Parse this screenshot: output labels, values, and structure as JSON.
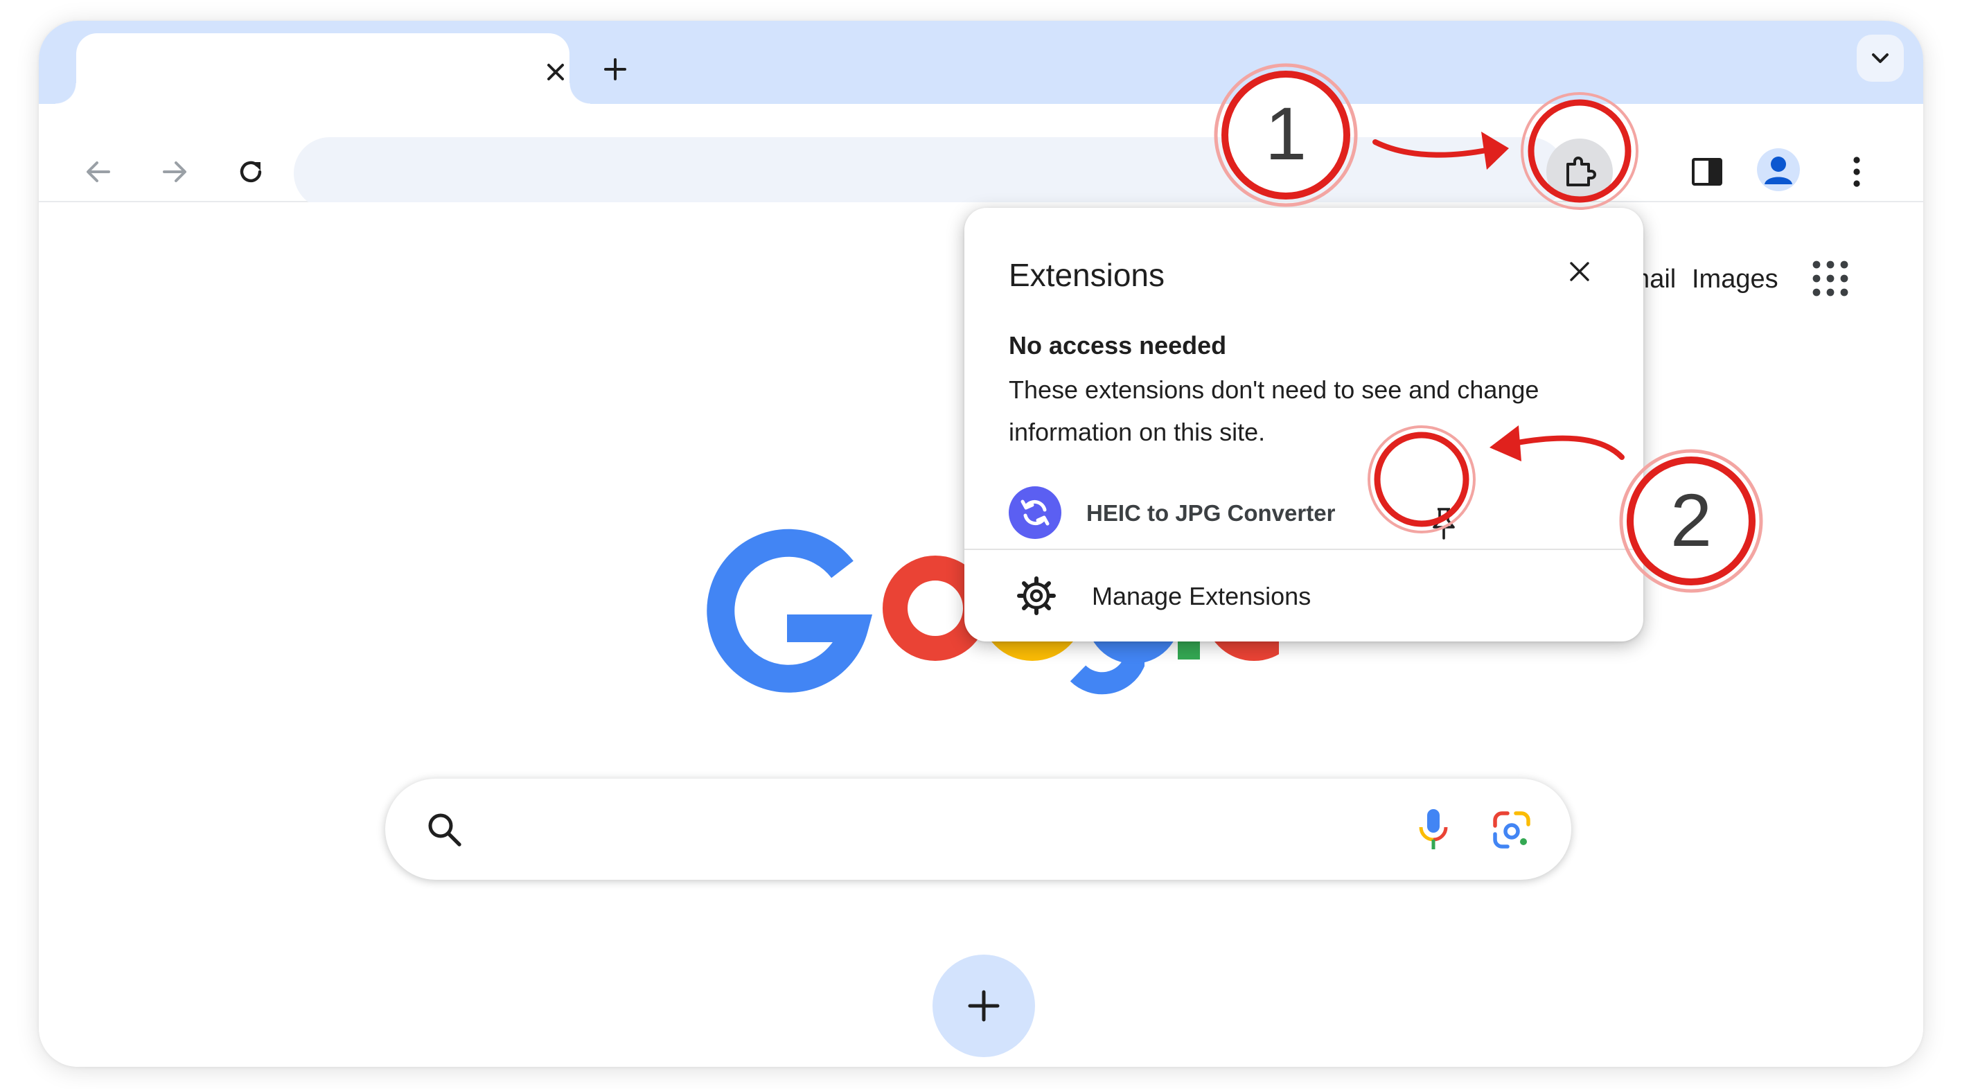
{
  "tab": {
    "title": ""
  },
  "toolbar": {
    "address": ""
  },
  "page_links": [
    "Gmail",
    "Images"
  ],
  "extensions_popup": {
    "title": "Extensions",
    "section_heading": "No access needed",
    "section_description": "These extensions don't need to see and change information on this site.",
    "extension_name": "HEIC to JPG Converter",
    "manage_label": "Manage Extensions"
  },
  "callouts": [
    "1",
    "2"
  ],
  "colors": {
    "tabstrip": "#d3e3fd",
    "callout_red": "#e0211d",
    "google_blue": "#4285f4",
    "google_red": "#ea4335",
    "google_yellow": "#fbbc05",
    "google_green": "#34a853",
    "extension_logo": "#5b5ff2"
  },
  "icons": [
    "close-icon",
    "plus-icon",
    "chevron-down-icon",
    "back-arrow-icon",
    "forward-arrow-icon",
    "reload-icon",
    "puzzle-icon",
    "side-panel-icon",
    "profile-icon",
    "kebab-menu-icon",
    "apps-grid-icon",
    "search-icon",
    "microphone-icon",
    "google-lens-icon",
    "sync-icon",
    "pin-icon",
    "gear-icon"
  ]
}
